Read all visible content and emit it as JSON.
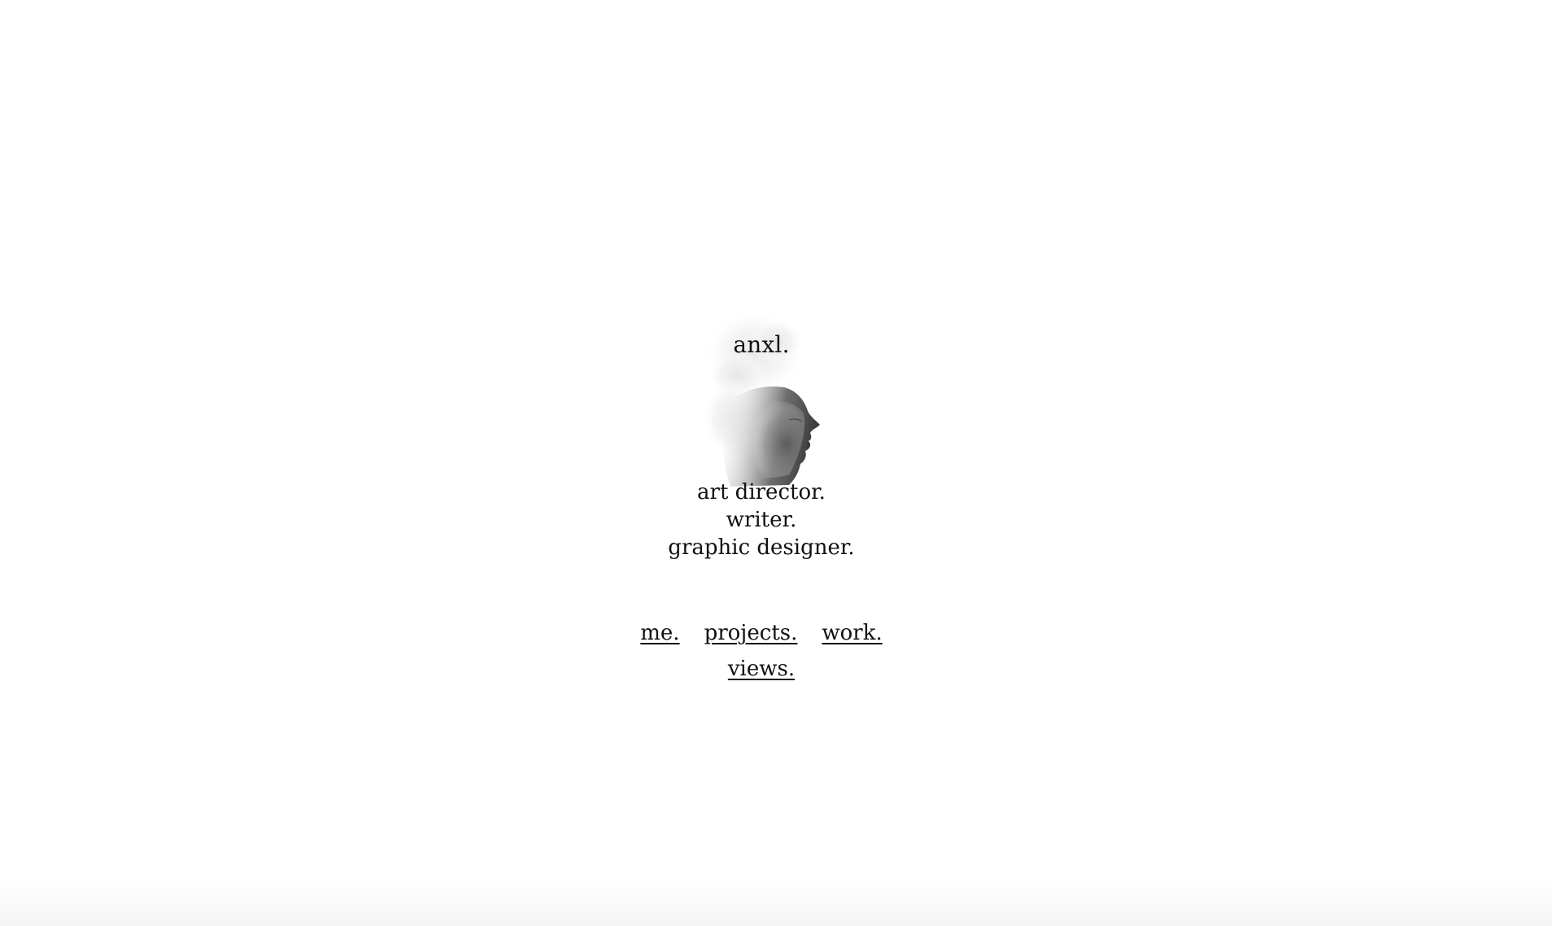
{
  "site": {
    "title": "anxl."
  },
  "hero": {
    "image_icon": "sculpted-face-portrait-icon"
  },
  "roles": [
    "art director.",
    "writer.",
    "graphic designer."
  ],
  "nav": {
    "row1": [
      "me.",
      "projects.",
      "work."
    ],
    "row2": [
      "views."
    ]
  },
  "colors": {
    "background": "#ffffff",
    "text": "#111111"
  }
}
